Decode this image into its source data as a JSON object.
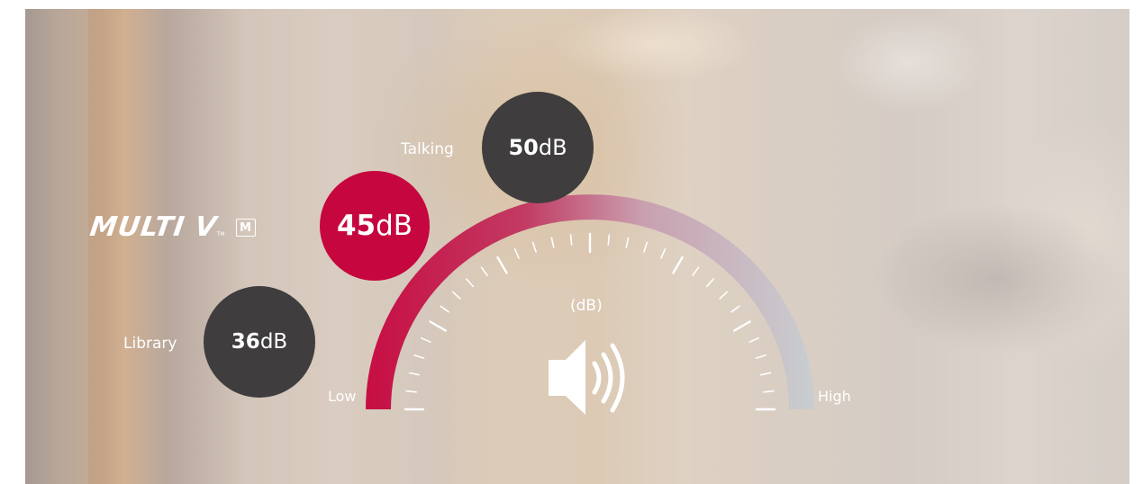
{
  "brand": {
    "logo_text": "MULTI V",
    "logo_tm": "TM",
    "logo_badge": "M"
  },
  "levels": {
    "talking": {
      "label": "Talking",
      "value": "50",
      "unit": "dB"
    },
    "multiv": {
      "value": "45",
      "unit": "dB"
    },
    "library": {
      "label": "Library",
      "value": "36",
      "unit": "dB"
    }
  },
  "gauge": {
    "unit_label": "(dB)",
    "low_label": "Low",
    "high_label": "High",
    "icon": "speaker-volume-icon",
    "colors": {
      "low": "#c5063f",
      "high": "#c9cdd0"
    }
  },
  "colors": {
    "accent_red": "#c5063f",
    "dark_bubble": "#3f3d3d"
  }
}
